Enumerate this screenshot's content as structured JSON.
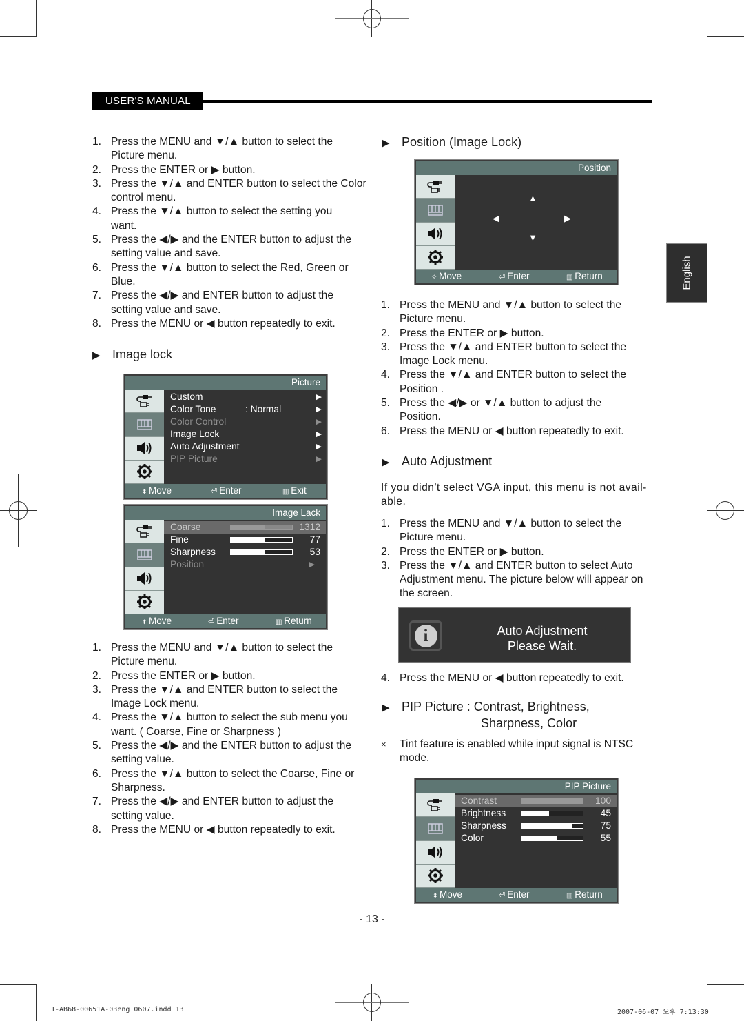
{
  "header": {
    "title": "USER'S MANUAL"
  },
  "language_tab": "English",
  "left_column": {
    "color_steps": [
      {
        "num": "1.",
        "text": "Press the MENU and ▼/▲ button to select the Picture menu."
      },
      {
        "num": "2.",
        "text": "Press the ENTER or ▶ button."
      },
      {
        "num": "3.",
        "text": "Press the ▼/▲ and ENTER button to select the Color control menu."
      },
      {
        "num": "4.",
        "text": "Press the ▼/▲ button to select the setting you want."
      },
      {
        "num": "5.",
        "text": "Press the ◀/▶ and the ENTER button to adjust the setting value and save."
      },
      {
        "num": "6.",
        "text": "Press the ▼/▲ button to select the Red, Green or Blue."
      },
      {
        "num": "7.",
        "text": "Press the ◀/▶ and ENTER button to adjust the setting value and save."
      },
      {
        "num": "8.",
        "text": "Press the MENU or ◀ button repeatedly to exit."
      }
    ],
    "image_lock_title": "Image lock",
    "image_lock_steps": [
      {
        "num": "1.",
        "text": "Press the MENU and ▼/▲ button to select the Picture menu."
      },
      {
        "num": "2.",
        "text": "Press the ENTER or ▶ button."
      },
      {
        "num": "3.",
        "text": "Press the  ▼/▲ and ENTER button to select the Image  Lock menu."
      },
      {
        "num": "4.",
        "text": "Press the ▼/▲ button to select the sub menu you want. ( Coarse, Fine or Sharpness )"
      },
      {
        "num": "5.",
        "text": "Press the ◀/▶ and the ENTER button to adjust the setting value."
      },
      {
        "num": "6.",
        "text": "Press the ▼/▲ button to select the Coarse, Fine or Sharpness."
      },
      {
        "num": "7.",
        "text": "Press the ◀/▶ and ENTER button to adjust the setting value."
      },
      {
        "num": "8.",
        "text": "Press the MENU or ◀ button repeatedly to exit."
      }
    ]
  },
  "right_column": {
    "position_title": "Position (Image Lock)",
    "position_steps": [
      {
        "num": "1.",
        "text": "Press the MENU and ▼/▲ button to select the Picture menu."
      },
      {
        "num": "2.",
        "text": "Press  the ENTER or ▶ button."
      },
      {
        "num": "3.",
        "text": "Press  the ▼/▲ and ENTER button to select the Image  Lock menu."
      },
      {
        "num": "4.",
        "text": "Press the ▼/▲ and ENTER button to select the Position  ."
      },
      {
        "num": "5.",
        "text": "Press the ◀/▶ or  ▼/▲  button to adjust the Position."
      },
      {
        "num": "6.",
        "text": "Press the MENU or ◀ button repeatedly to exit."
      }
    ],
    "auto_title": "Auto Adjustment",
    "auto_note": "If you didn't select VGA input, this menu is not avail-able.",
    "auto_steps": [
      {
        "num": "1.",
        "text": "Press the MENU and ▼/▲ button to select the Picture menu."
      },
      {
        "num": "2.",
        "text": "Press the ENTER or ▶ button."
      },
      {
        "num": "3.",
        "text": "Press the ▼/▲ and ENTER button to select Auto Adjustment menu. The picture below will appear on the screen."
      }
    ],
    "auto_step4": {
      "num": "4.",
      "text": "Press the MENU or ◀ button repeatedly to exit."
    },
    "pip_title_line1": "PIP Picture : Contrast, Brightness,",
    "pip_title_line2": "Sharpness, Color",
    "pip_note_mark": "×",
    "pip_note": "Tint feature is enabled while input signal is NTSC mode."
  },
  "osd_picture": {
    "title": "Picture",
    "items": [
      {
        "label": "Custom",
        "value": "",
        "state": "normal"
      },
      {
        "label": "Color Tone",
        "value": ": Normal",
        "state": "normal"
      },
      {
        "label": "Color Control",
        "value": "",
        "state": "dim"
      },
      {
        "label": "Image Lock",
        "value": "",
        "state": "normal"
      },
      {
        "label": "Auto Adjustment",
        "value": "",
        "state": "normal"
      },
      {
        "label": "PIP Picture",
        "value": "",
        "state": "dim"
      }
    ],
    "footer": {
      "move": "Move",
      "enter": "Enter",
      "exit": "Exit"
    }
  },
  "osd_image_lock": {
    "title": "Image Lack",
    "items": [
      {
        "label": "Coarse",
        "value": "1312",
        "level": 0.55,
        "state": "selected"
      },
      {
        "label": "Fine",
        "value": "77",
        "level": 0.55,
        "state": "normal"
      },
      {
        "label": "Sharpness",
        "value": "53",
        "level": 0.55,
        "state": "normal"
      },
      {
        "label": "Position",
        "value": "",
        "state": "dim"
      }
    ],
    "footer": {
      "move": "Move",
      "enter": "Enter",
      "return": "Return"
    }
  },
  "osd_position": {
    "title": "Position",
    "arrows": {
      "up": "▲",
      "down": "▼",
      "left": "◀",
      "right": "▶"
    },
    "footer": {
      "move": "Move",
      "enter": "Enter",
      "return": "Return"
    }
  },
  "osd_auto": {
    "line1": "Auto Adjustment",
    "line2": "Please Wait."
  },
  "osd_pip": {
    "title": "PIP Picture",
    "items": [
      {
        "label": "Contrast",
        "value": "100",
        "level": 1.0,
        "state": "selected"
      },
      {
        "label": "Brightness",
        "value": "45",
        "level": 0.45,
        "state": "normal"
      },
      {
        "label": "Sharpness",
        "value": "75",
        "level": 0.82,
        "state": "normal"
      },
      {
        "label": "Color",
        "value": "55",
        "level": 0.58,
        "state": "normal"
      }
    ],
    "footer": {
      "move": "Move",
      "enter": "Enter",
      "return": "Return"
    }
  },
  "page_number": "- 13 -",
  "slug_left": "1-AB68-00651A-03eng_0607.indd   13",
  "slug_right": "2007-06-07   오후 7:13:30",
  "colors": {
    "osd_bg": "#333333",
    "osd_bar": "#5e7673",
    "sidebar": "#dde6e4",
    "sidebar_active": "#6d807d"
  }
}
